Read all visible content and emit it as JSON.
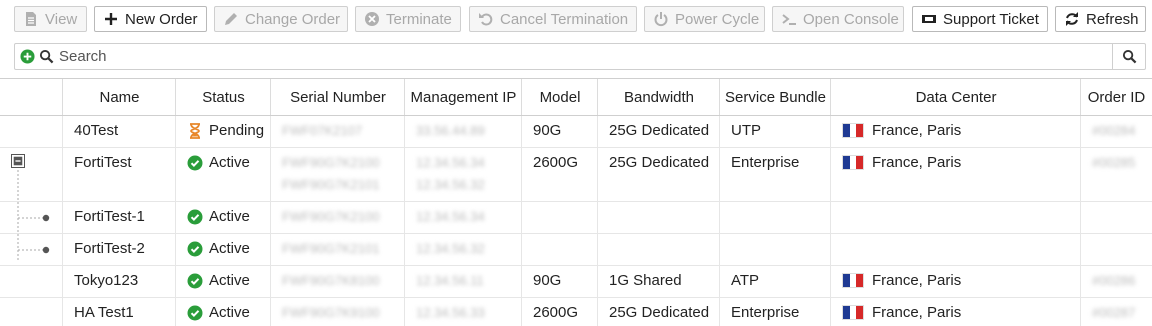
{
  "toolbar": {
    "view": "View",
    "new_order": "New Order",
    "change_order": "Change Order",
    "terminate": "Terminate",
    "cancel_termination": "Cancel Termination",
    "power_cycle": "Power Cycle",
    "open_console": "Open Console",
    "support_ticket": "Support Ticket",
    "refresh": "Refresh"
  },
  "search": {
    "placeholder": "Search"
  },
  "columns": {
    "name": "Name",
    "status": "Status",
    "serial": "Serial Number",
    "mgmt_ip": "Management IP",
    "model": "Model",
    "bandwidth": "Bandwidth",
    "bundle": "Service Bundle",
    "datacenter": "Data Center",
    "order_id": "Order ID"
  },
  "rows": [
    {
      "name": "40Test",
      "status": "Pending",
      "status_icon": "hourglass-icon",
      "serial": "FWF07K2107",
      "serial2": "",
      "ip": "33.56.44.89",
      "ip2": "",
      "model": "90G",
      "bandwidth": "25G Dedicated",
      "bundle": "UTP",
      "datacenter": "France, Paris",
      "order_id": "#00284"
    },
    {
      "name": "FortiTest",
      "status": "Active",
      "status_icon": "check-circle-icon",
      "serial": "FWF90G7K2100",
      "serial2": "FWF90G7K2101",
      "ip": "12.34.56.34",
      "ip2": "12.34.56.32",
      "model": "2600G",
      "bandwidth": "25G Dedicated",
      "bundle": "Enterprise",
      "datacenter": "France, Paris",
      "order_id": "#00285"
    },
    {
      "name": "FortiTest-1",
      "status": "Active",
      "status_icon": "check-circle-icon",
      "serial": "FWF90G7K2100",
      "serial2": "",
      "ip": "12.34.56.34",
      "ip2": "",
      "model": "",
      "bandwidth": "",
      "bundle": "",
      "datacenter": "",
      "order_id": ""
    },
    {
      "name": "FortiTest-2",
      "status": "Active",
      "status_icon": "check-circle-icon",
      "serial": "FWF90G7K2101",
      "serial2": "",
      "ip": "12.34.56.32",
      "ip2": "",
      "model": "",
      "bandwidth": "",
      "bundle": "",
      "datacenter": "",
      "order_id": ""
    },
    {
      "name": "Tokyo123",
      "status": "Active",
      "status_icon": "check-circle-icon",
      "serial": "FWF90G7K8100",
      "serial2": "",
      "ip": "12.34.56.11",
      "ip2": "",
      "model": "90G",
      "bandwidth": "1G Shared",
      "bundle": "ATP",
      "datacenter": "France, Paris",
      "order_id": "#00286"
    },
    {
      "name": "HA Test1",
      "status": "Active",
      "status_icon": "check-circle-icon",
      "serial": "FWF90G7K9100",
      "serial2": "",
      "ip": "12.34.56.33",
      "ip2": "",
      "model": "2600G",
      "bandwidth": "25G Dedicated",
      "bundle": "Enterprise",
      "datacenter": "France, Paris",
      "order_id": "#00287"
    }
  ],
  "colors": {
    "active_green": "#2a9d3a",
    "pending_orange": "#e8872a",
    "flag_blue": "#1f3a93",
    "flag_red": "#d62828"
  }
}
